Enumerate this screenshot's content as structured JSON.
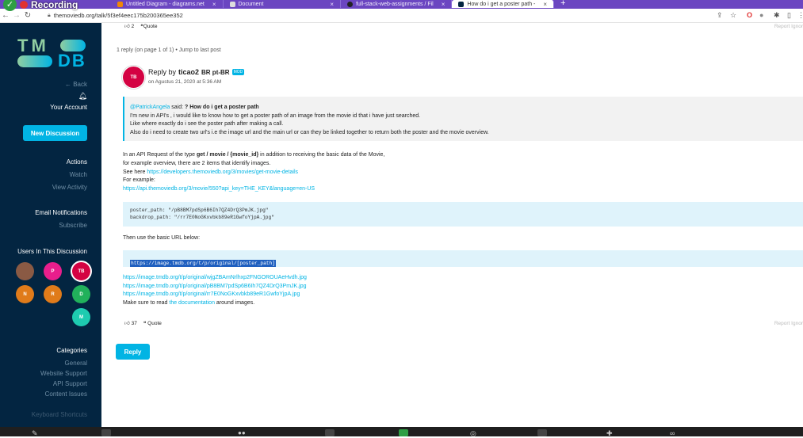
{
  "browser": {
    "recording_label": "Recording",
    "tabs": [
      {
        "label": "Untitled Diagram - diagrams.net",
        "color": "#f08705"
      },
      {
        "label": "Document",
        "color": "#dddddd"
      },
      {
        "label": "full-stack-web-assignments / Fil",
        "color": "#222222"
      },
      {
        "label": "How do i get a poster path - ",
        "color": "#032541"
      }
    ],
    "new_tab": "+",
    "url": "themoviedb.org/talk/5f3ef4eec175b200365ee352"
  },
  "sidebar": {
    "logo_top": "TM",
    "logo_bottom": "DB",
    "back": "← Back",
    "your_account": "Your Account",
    "new_discussion": "New Discussion",
    "actions_heading": "Actions",
    "watch": "Watch",
    "view_activity": "View Activity",
    "email_heading": "Email Notifications",
    "subscribe": "Subscribe",
    "users_heading": "Users In This Discussion",
    "users": [
      {
        "initials": "",
        "color": "#8a5a44"
      },
      {
        "initials": "P",
        "color": "#e91e8c"
      },
      {
        "initials": "TB",
        "color": "#d40242"
      },
      {
        "initials": "N",
        "color": "#e07b1a"
      },
      {
        "initials": "R",
        "color": "#e07b1a"
      },
      {
        "initials": "D",
        "color": "#21b15b"
      },
      {
        "initials": "M",
        "color": "#1ecbb0"
      }
    ],
    "categories_heading": "Categories",
    "categories": [
      "General",
      "Website Support",
      "API Support",
      "Content Issues"
    ],
    "keyboard": "Keyboard Shortcuts"
  },
  "post": {
    "top_likes": "2",
    "quote_label": "Quote",
    "top_report": "Report   Ignor",
    "reply_count": "1 reply (on page 1 of 1) • Jump to last post",
    "reply_by_prefix": "Reply by",
    "author": "ticao2",
    "author_flag": "BR pt-BR",
    "mod_badge": "MOD",
    "date": "on Agustus 21, 2020 at 5:36 AM",
    "quote": {
      "author": "@PatrickAngela",
      "said": " said: ",
      "title": "? How do i get a poster path",
      "lines": [
        "I'm new in API's , i would like to know how to get a poster path of an image from the movie id that i have just searched.",
        "Like where exactly do i see the poster path after making a call.",
        "Also do i need to create two url's i.e the image url and the main url or can they be linked together to return both the poster and the movie overview."
      ]
    },
    "body_line1_pre": "In an API Request of the type ",
    "body_line1_bold": "get / movie / {movie_id}",
    "body_line1_post": " in addition to receiving the basic data of the Movie,",
    "body_line2": "for example overview, there are 2 items that identify images.",
    "see_here": "See here ",
    "see_here_link": "https://developers.themoviedb.org/3/movies/get-movie-details",
    "for_example": "For example:",
    "example_link": "https://api.themoviedb.org/3/movie/550?api_key=THE_KEY&language=en-US",
    "code_line1": "poster_path: \"/pB8BM7pdSp6B6Ih7QZ4DrQ3PmJK.jpg\"",
    "code_line2": "backdrop_path: \"/rr7E0NoGKxvbkb89eR1GwfoYjpA.jpg\"",
    "then_use": "Then use the basic URL below:",
    "base_url": "https://image.tmdb.org/t/p/original/[poster_path]",
    "image_links": [
      "https://image.tmdb.org/t/p/original/wjgZBAmNrlhxp2FNGOROUAeHvdh.jpg",
      "https://image.tmdb.org/t/p/original/pB8BM7pdSp6B6Ih7QZ4DrQ3PmJK.jpg",
      "https://image.tmdb.org/t/p/original/rr7E0NoGKxvbkb89eR1GwfoYjpA.jpg"
    ],
    "make_sure": "Make sure to read ",
    "documentation": "the documentation",
    "around": " around images.",
    "likes": "37",
    "bottom_report": "Report   Ignor",
    "reply_button": "Reply"
  }
}
